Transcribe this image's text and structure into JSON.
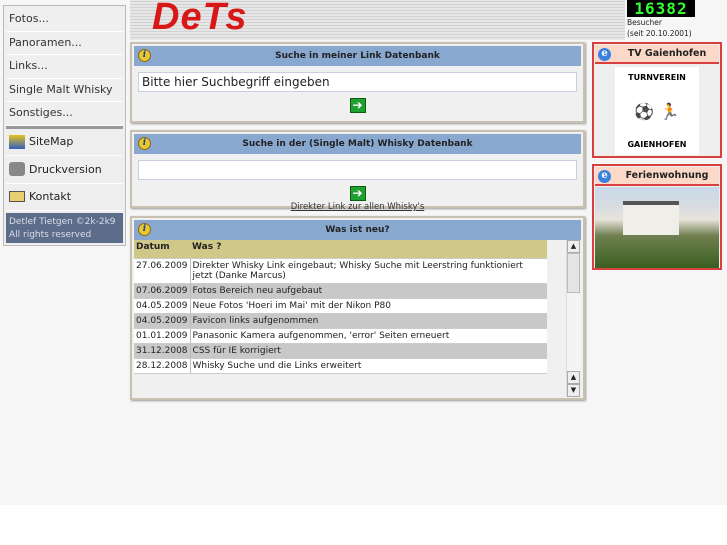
{
  "nav": {
    "items": [
      "Fotos...",
      "Panoramen...",
      "Links...",
      "Single Malt Whisky",
      "Sonstiges..."
    ],
    "tools": [
      {
        "label": "SiteMap",
        "icon": "sitemap-icon"
      },
      {
        "label": "Druckversion",
        "icon": "printer-icon"
      },
      {
        "label": "Kontakt",
        "icon": "envelope-icon"
      }
    ],
    "copyright_1": "Detlef Tietgen ©2k-2k9",
    "copyright_2": "All rights reserved"
  },
  "header": {
    "logo": "DeTs",
    "counter": "16382",
    "counter_label": "Besucher",
    "counter_since": "(seit 20.10.2001)"
  },
  "link_search": {
    "title": "Suche in meiner Link Datenbank",
    "value": "Bitte hier Suchbegriff eingeben",
    "go": "➔"
  },
  "whisky_search": {
    "title": "Suche in der (Single Malt) Whisky Datenbank",
    "value": "",
    "go": "➔",
    "direct_link": "Direkter Link zur allen Whisky's"
  },
  "news": {
    "title": "Was ist neu?",
    "col_date": "Datum",
    "col_what": "Was ?",
    "rows": [
      {
        "date": "27.06.2009",
        "text": "Direkter Whisky Link eingebaut; Whisky Suche mit Leerstring funktioniert jetzt (Danke Marcus)"
      },
      {
        "date": "07.06.2009",
        "text": "Fotos Bereich neu aufgebaut"
      },
      {
        "date": "04.05.2009",
        "text": "Neue Fotos 'Hoeri im Mai' mit der Nikon P80"
      },
      {
        "date": "04.05.2009",
        "text": "Favicon links aufgenommen"
      },
      {
        "date": "01.01.2009",
        "text": "Panasonic Kamera aufgenommen, 'error' Seiten erneuert"
      },
      {
        "date": "31.12.2008",
        "text": "CSS für IE korrigiert"
      },
      {
        "date": "28.12.2008",
        "text": "Whisky Suche und die Links erweitert"
      }
    ]
  },
  "side": {
    "tv_title": "TV Gaienhofen",
    "tv_logo_top": "TURNVEREIN",
    "tv_logo_bottom": "GAIENHOFEN",
    "fw_title": "Ferienwohnung Weber"
  }
}
